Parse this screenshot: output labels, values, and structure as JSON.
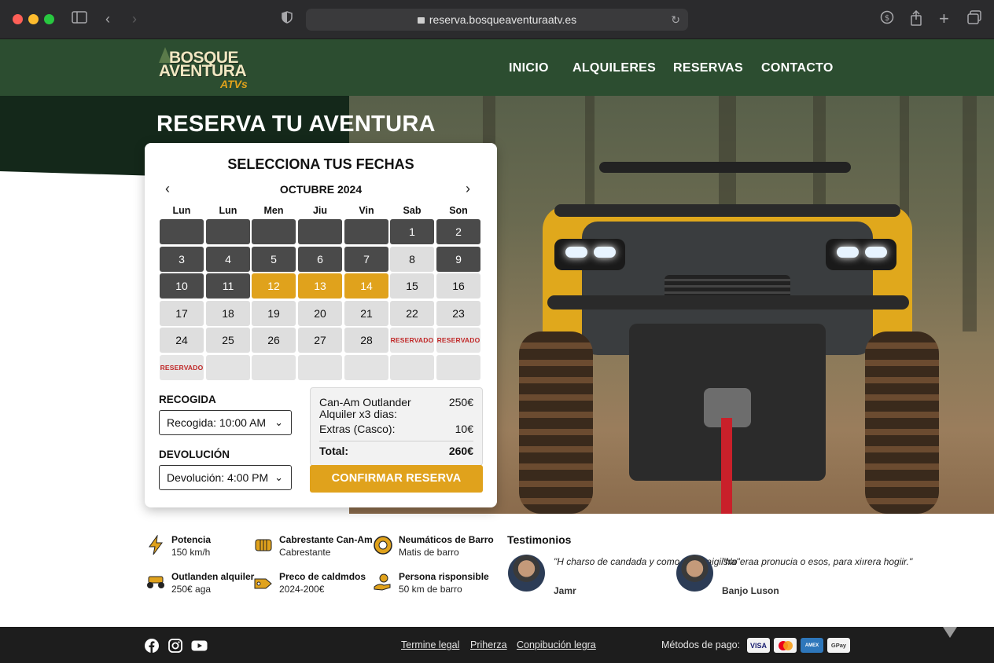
{
  "browser": {
    "url": "reserva.bosqueaventuraatv.es"
  },
  "logo": {
    "line1": "BOSQUE",
    "line2": "AVENTURA",
    "line3": "ATVs"
  },
  "nav": [
    {
      "label": "INICIO"
    },
    {
      "label": "ALQUILERES"
    },
    {
      "label": "RESERVAS"
    },
    {
      "label": "CONTACTO"
    }
  ],
  "hero": {
    "title": "RESERVA TU AVENTURA"
  },
  "booking": {
    "title": "SELECCIONA TUS FECHAS",
    "month": "OCTUBRE 2024",
    "weekdays": [
      "Lun",
      "Lun",
      "Men",
      "Jiu",
      "Vin",
      "Sab",
      "Son"
    ],
    "days": [
      {
        "t": "",
        "s": "dark"
      },
      {
        "t": "",
        "s": "dark"
      },
      {
        "t": "",
        "s": "dark"
      },
      {
        "t": "",
        "s": "dark"
      },
      {
        "t": "",
        "s": "dark"
      },
      {
        "t": "1",
        "s": "dark"
      },
      {
        "t": "2",
        "s": "dark"
      },
      {
        "t": "3",
        "s": "dark"
      },
      {
        "t": "4",
        "s": "dark"
      },
      {
        "t": "5",
        "s": "dark"
      },
      {
        "t": "6",
        "s": "dark"
      },
      {
        "t": "7",
        "s": "dark"
      },
      {
        "t": "8",
        "s": "avail"
      },
      {
        "t": "9",
        "s": "dark"
      },
      {
        "t": "10",
        "s": "dark"
      },
      {
        "t": "11",
        "s": "dark"
      },
      {
        "t": "12",
        "s": "sel"
      },
      {
        "t": "13",
        "s": "sel"
      },
      {
        "t": "14",
        "s": "sel"
      },
      {
        "t": "15",
        "s": "avail"
      },
      {
        "t": "16",
        "s": "avail"
      },
      {
        "t": "17",
        "s": "avail"
      },
      {
        "t": "18",
        "s": "avail"
      },
      {
        "t": "19",
        "s": "avail"
      },
      {
        "t": "20",
        "s": "avail"
      },
      {
        "t": "21",
        "s": "avail"
      },
      {
        "t": "22",
        "s": "avail"
      },
      {
        "t": "23",
        "s": "avail"
      },
      {
        "t": "24",
        "s": "avail"
      },
      {
        "t": "25",
        "s": "avail"
      },
      {
        "t": "26",
        "s": "avail"
      },
      {
        "t": "27",
        "s": "avail"
      },
      {
        "t": "28",
        "s": "avail"
      },
      {
        "t": "RESERVADO",
        "s": "res"
      },
      {
        "t": "RESERVADO",
        "s": "res"
      },
      {
        "t": "RESERVADO",
        "s": "res"
      },
      {
        "t": "",
        "s": "empty"
      },
      {
        "t": "",
        "s": "empty"
      },
      {
        "t": "",
        "s": "empty"
      },
      {
        "t": "",
        "s": "empty"
      },
      {
        "t": "",
        "s": "empty"
      },
      {
        "t": "",
        "s": "empty"
      }
    ],
    "pickup_label": "RECOGIDA",
    "pickup_value": "Recogida: 10:00 AM",
    "return_label": "DEVOLUCIÓN",
    "return_value": "Devolución: 4:00 PM",
    "summary": {
      "item_line1": "Can-Am Outlander",
      "item_line2": "Alquiler x3 dias:",
      "item_price": "250€",
      "extras_label": "Extras (Casco):",
      "extras_price": "10€",
      "total_label": "Total:",
      "total_price": "260€"
    },
    "confirm_label": "CONFIRMAR RESERVA"
  },
  "features": [
    {
      "icon": "lightning-icon",
      "title": "Potencia",
      "sub": "150 km/h"
    },
    {
      "icon": "winch-icon",
      "title": "Cabrestante Can-Am",
      "sub": "Cabrestante"
    },
    {
      "icon": "tire-icon",
      "title": "Neumáticos de Barro",
      "sub": "Matis de barro"
    },
    {
      "icon": "atv-icon",
      "title": "Outlanden alquiler",
      "sub": "250€ aga"
    },
    {
      "icon": "price-tag-icon",
      "title": "Preco de caldmdos",
      "sub": "2024-200€"
    },
    {
      "icon": "hand-icon",
      "title": "Persona risponsible",
      "sub": "50 km de barro"
    }
  ],
  "testimonials": {
    "heading": "Testimonios",
    "items": [
      {
        "quote": "\"H charso de candada y como trairo aigiisra\"",
        "name": "Jamr"
      },
      {
        "quote": "\"No eraa pronucia o esos, para xiırera hogiir.\"",
        "name": "Banjo Luson"
      }
    ]
  },
  "footer": {
    "links": [
      "Termine legal",
      "Priherza",
      "Conpibución legra"
    ],
    "payment_label": "Métodos de pago:",
    "payments": [
      "VISA",
      "MC",
      "AMEX",
      "GPay"
    ]
  },
  "colors": {
    "header_green": "#2c4d30",
    "accent_gold": "#e0a21c",
    "reserved_red": "#c02828"
  }
}
